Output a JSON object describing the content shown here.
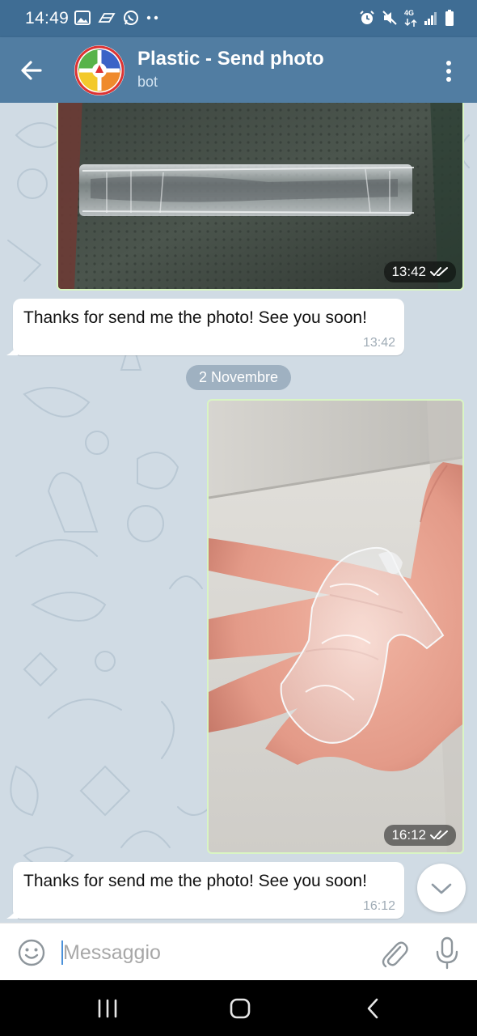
{
  "status_bar": {
    "time": "14:49",
    "left_icons": [
      "image-icon",
      "cast-icon",
      "whatsapp-icon",
      "more-dots-icon"
    ],
    "right_icons": [
      "alarm-icon",
      "mute-icon",
      "network-4g-icon",
      "signal-icon",
      "battery-icon"
    ],
    "network_label": "4G"
  },
  "app_bar": {
    "title": "Plastic - Send photo",
    "subtitle": "bot",
    "accent": "#517da2"
  },
  "messages": [
    {
      "type": "photo",
      "side": "outgoing",
      "subject": "cutlery-in-plastic-wrap",
      "time": "13:42",
      "status": "read"
    },
    {
      "type": "text",
      "side": "incoming",
      "text": "Thanks for send me the photo! See you soon!",
      "time": "13:42"
    },
    {
      "type": "date",
      "text": "2 Novembre"
    },
    {
      "type": "photo",
      "side": "outgoing",
      "subject": "plastic-wrapper-in-hand",
      "time": "16:12",
      "status": "read"
    },
    {
      "type": "text",
      "side": "incoming",
      "text": "Thanks for send me the photo! See you soon!",
      "time": "16:12"
    }
  ],
  "input": {
    "placeholder": "Messaggio"
  },
  "colors": {
    "chat_background": "#d0dbe4",
    "outgoing_border": "#d9f5c3",
    "date_pill": "#9fb1c1"
  }
}
